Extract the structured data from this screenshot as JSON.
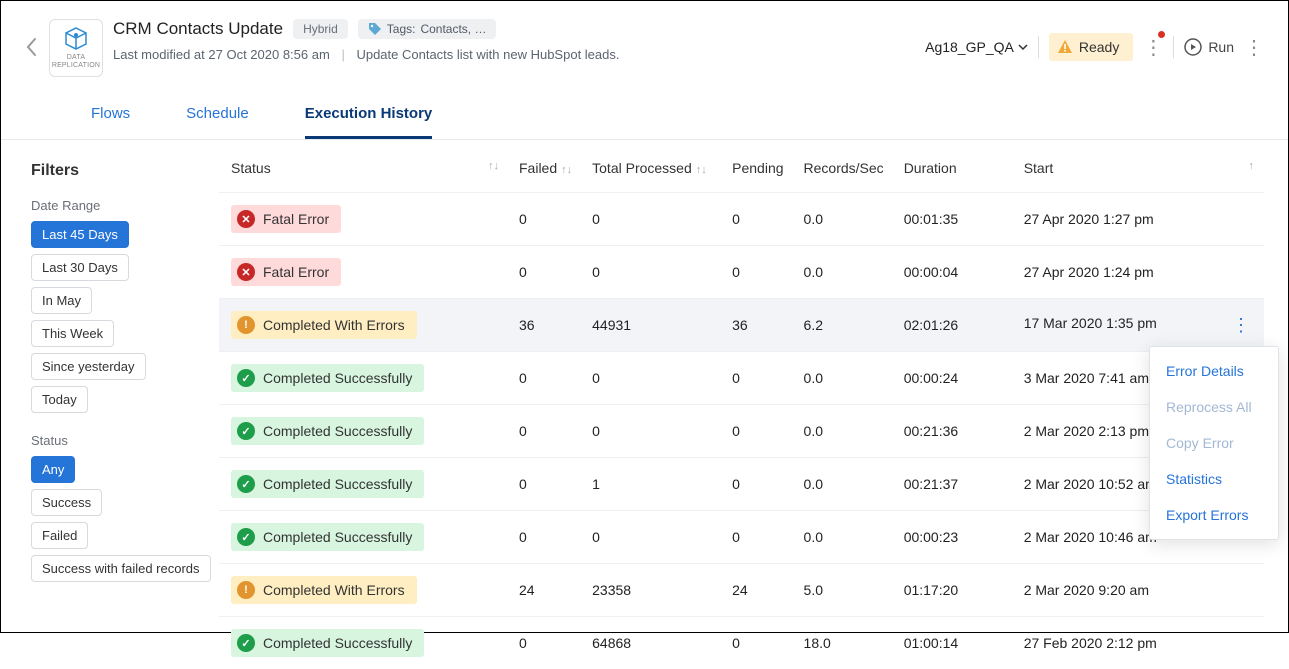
{
  "header": {
    "app_icon_label": "DATA REPLICATION",
    "title": "CRM Contacts Update",
    "hybrid": "Hybrid",
    "tags_label": "Tags:",
    "tags_value": "Contacts, …",
    "last_modified": "Last modified at 27 Oct 2020 8:56 am",
    "description": "Update Contacts list with new HubSpot leads.",
    "agent": "Ag18_GP_QA",
    "ready_label": "Ready",
    "run_label": "Run"
  },
  "tabs": {
    "flows": "Flows",
    "schedule": "Schedule",
    "history": "Execution History"
  },
  "filters": {
    "title": "Filters",
    "date_range_label": "Date Range",
    "date_range": [
      {
        "label": "Last 45 Days",
        "active": true
      },
      {
        "label": "Last 30 Days"
      },
      {
        "label": "In May"
      },
      {
        "label": "This Week"
      },
      {
        "label": "Since yesterday"
      },
      {
        "label": "Today"
      }
    ],
    "status_label": "Status",
    "status": [
      {
        "label": "Any",
        "active": true
      },
      {
        "label": "Success"
      },
      {
        "label": "Failed"
      },
      {
        "label": "Success with failed records"
      }
    ]
  },
  "columns": {
    "status": "Status",
    "failed": "Failed",
    "total": "Total Processed",
    "pending": "Pending",
    "rps": "Records/Sec",
    "duration": "Duration",
    "start": "Start"
  },
  "status_labels": {
    "fatal": "Fatal Error",
    "warn": "Completed With Errors",
    "ok": "Completed Successfully"
  },
  "rows": [
    {
      "status": "fatal",
      "failed": "0",
      "total": "0",
      "pending": "0",
      "rps": "0.0",
      "duration": "00:01:35",
      "start": "27 Apr 2020 1:27 pm"
    },
    {
      "status": "fatal",
      "failed": "0",
      "total": "0",
      "pending": "0",
      "rps": "0.0",
      "duration": "00:00:04",
      "start": "27 Apr 2020 1:24 pm"
    },
    {
      "status": "warn",
      "failed": "36",
      "total": "44931",
      "pending": "36",
      "rps": "6.2",
      "duration": "02:01:26",
      "start": "17 Mar 2020 1:35 pm",
      "hl": true
    },
    {
      "status": "ok",
      "failed": "0",
      "total": "0",
      "pending": "0",
      "rps": "0.0",
      "duration": "00:00:24",
      "start": "3 Mar 2020 7:41 am"
    },
    {
      "status": "ok",
      "failed": "0",
      "total": "0",
      "pending": "0",
      "rps": "0.0",
      "duration": "00:21:36",
      "start": "2 Mar 2020 2:13 pm"
    },
    {
      "status": "ok",
      "failed": "0",
      "total": "1",
      "pending": "0",
      "rps": "0.0",
      "duration": "00:21:37",
      "start": "2 Mar 2020 10:52 am"
    },
    {
      "status": "ok",
      "failed": "0",
      "total": "0",
      "pending": "0",
      "rps": "0.0",
      "duration": "00:00:23",
      "start": "2 Mar 2020 10:46 am"
    },
    {
      "status": "warn",
      "failed": "24",
      "total": "23358",
      "pending": "24",
      "rps": "5.0",
      "duration": "01:17:20",
      "start": "2 Mar 2020 9:20 am"
    },
    {
      "status": "ok",
      "failed": "0",
      "total": "64868",
      "pending": "0",
      "rps": "18.0",
      "duration": "01:00:14",
      "start": "27 Feb 2020 2:12 pm"
    }
  ],
  "menu": {
    "items": [
      {
        "label": "Error Details"
      },
      {
        "label": "Reprocess All",
        "disabled": true
      },
      {
        "label": "Copy Error",
        "disabled": true
      },
      {
        "label": "Statistics"
      },
      {
        "label": "Export Errors"
      }
    ]
  }
}
